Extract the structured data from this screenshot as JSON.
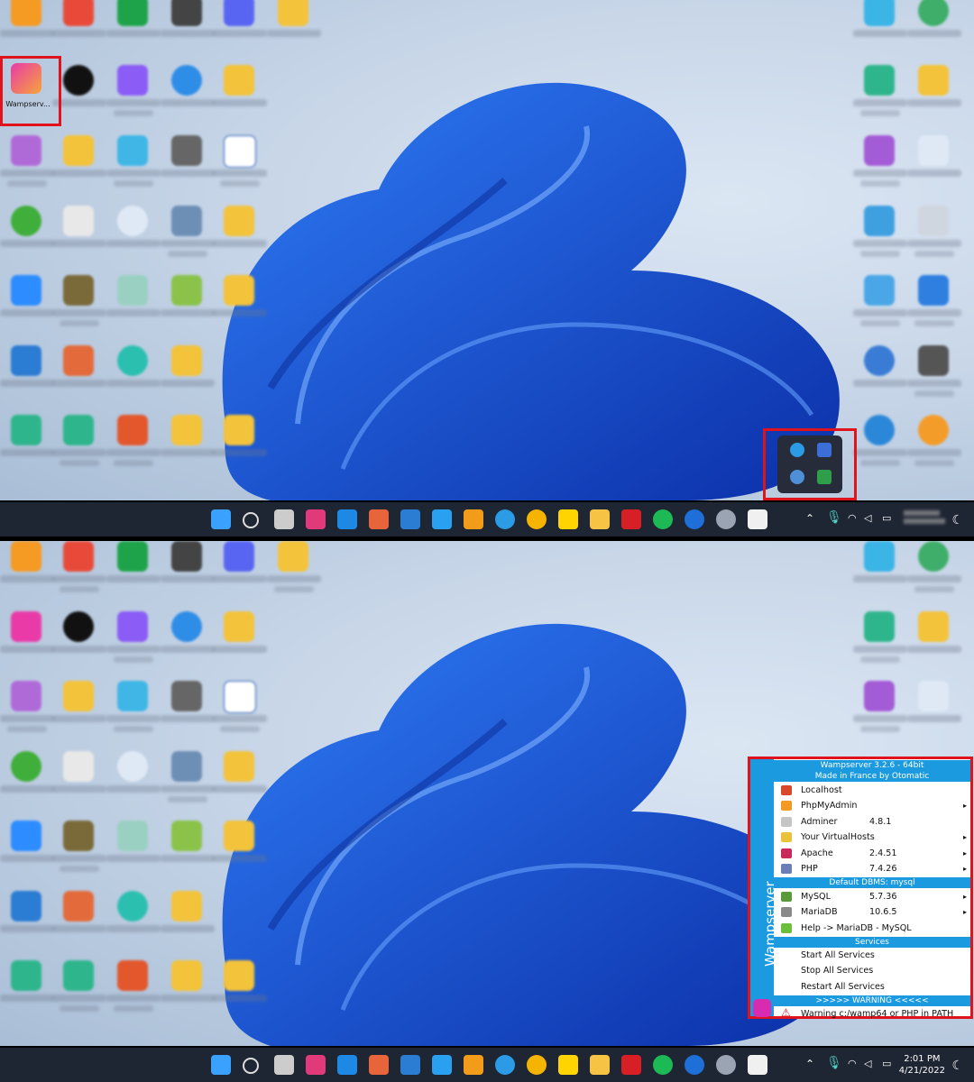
{
  "colors": {
    "accent_red": "#e0121b",
    "wamp_blue": "#1b9ae0",
    "taskbar_bg": "#1f2633"
  },
  "desktop": {
    "wamp_icon_label": "Wampserv..."
  },
  "taskbar": {
    "time_bottom": "2:01 PM",
    "date_bottom": "4/21/2022"
  },
  "wamp_menu": {
    "side_title": "Wampserver",
    "header_title": "Wampserver 3.2.6 - 64bit",
    "header_sub": "Made in France by Otomatic",
    "items_a": [
      {
        "name": "Localhost",
        "version": "",
        "arrow": ""
      },
      {
        "name": "PhpMyAdmin",
        "version": "",
        "arrow": "▸"
      },
      {
        "name": "Adminer",
        "version": "4.8.1",
        "arrow": ""
      },
      {
        "name": "Your VirtualHosts",
        "version": "",
        "arrow": "▸"
      },
      {
        "name": "Apache",
        "version": "2.4.51",
        "arrow": "▸"
      },
      {
        "name": "PHP",
        "version": "7.4.26",
        "arrow": "▸"
      }
    ],
    "dbms_header": "Default DBMS: mysql",
    "items_b": [
      {
        "name": "MySQL",
        "version": "5.7.36",
        "arrow": "▸"
      },
      {
        "name": "MariaDB",
        "version": "10.6.5",
        "arrow": "▸"
      },
      {
        "name": "Help -> MariaDB - MySQL",
        "version": "",
        "arrow": ""
      }
    ],
    "services_header": "Services",
    "services": [
      {
        "name": "Start All Services"
      },
      {
        "name": "Stop All Services"
      },
      {
        "name": "Restart All Services"
      }
    ],
    "warning_header": ">>>>>  WARNING  <<<<<",
    "warning_item": "Warning c:/wamp64 or PHP in PATH"
  }
}
